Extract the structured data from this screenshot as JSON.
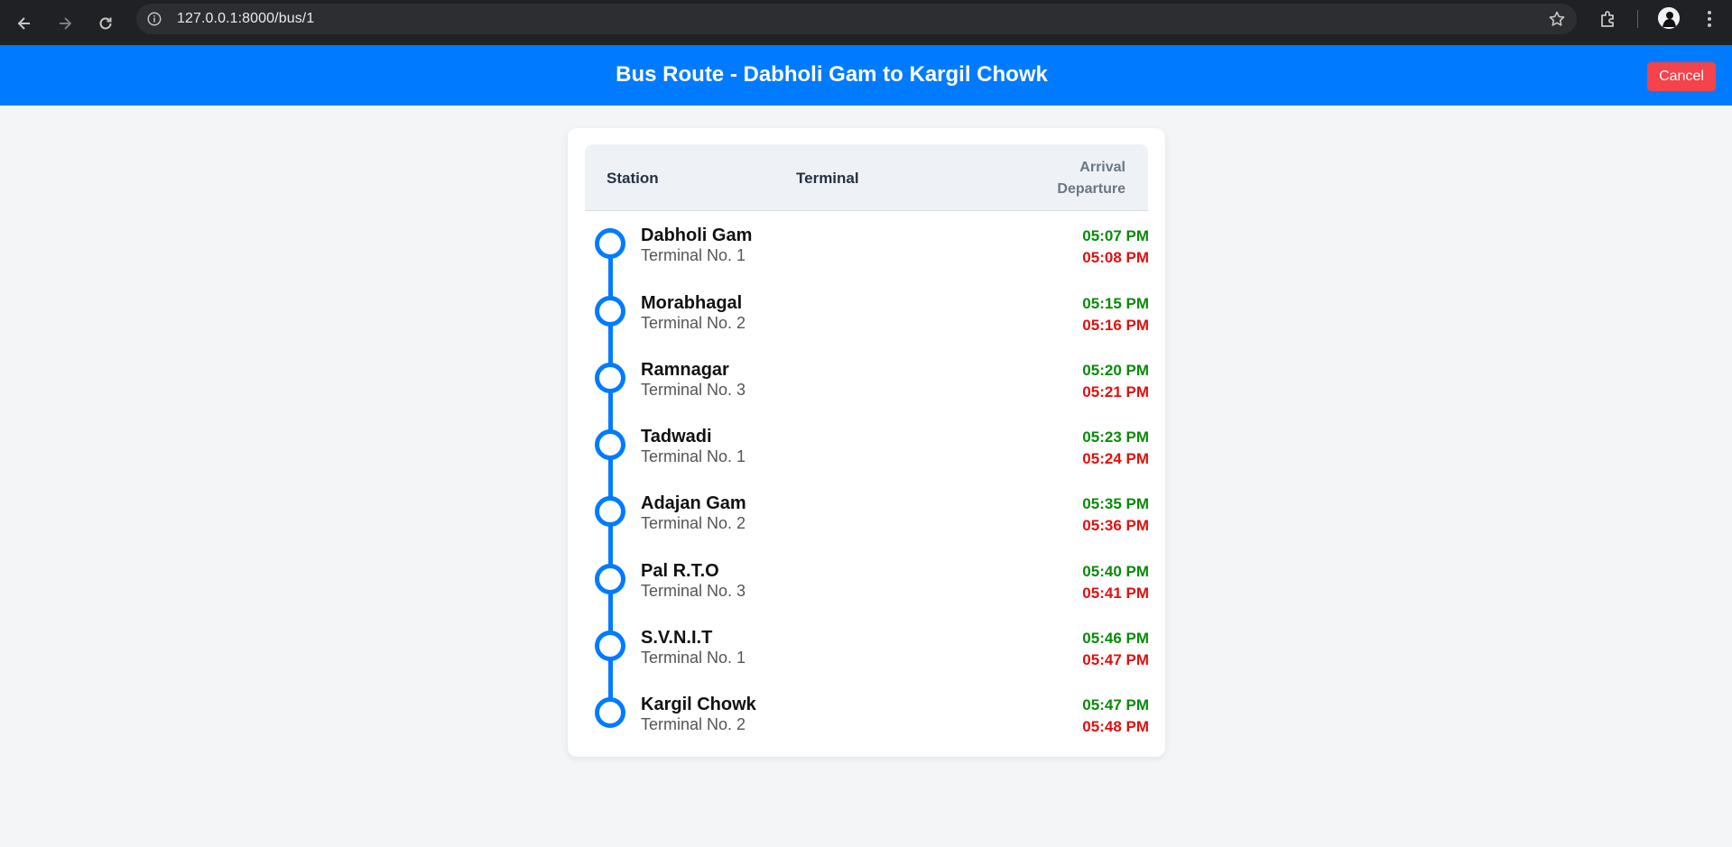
{
  "browser": {
    "url": "127.0.0.1:8000/bus/1"
  },
  "header": {
    "title": "Bus Route - Dabholi Gam to Kargil Chowk",
    "cancel_label": "Cancel"
  },
  "table": {
    "col_station": "Station",
    "col_terminal": "Terminal",
    "col_arrival": "Arrival",
    "col_departure": "Departure"
  },
  "stops": [
    {
      "name": "Dabholi Gam",
      "terminal": "Terminal No. 1",
      "arrival": "05:07 PM",
      "departure": "05:08 PM"
    },
    {
      "name": "Morabhagal",
      "terminal": "Terminal No. 2",
      "arrival": "05:15 PM",
      "departure": "05:16 PM"
    },
    {
      "name": "Ramnagar",
      "terminal": "Terminal No. 3",
      "arrival": "05:20 PM",
      "departure": "05:21 PM"
    },
    {
      "name": "Tadwadi",
      "terminal": "Terminal No. 1",
      "arrival": "05:23 PM",
      "departure": "05:24 PM"
    },
    {
      "name": "Adajan Gam",
      "terminal": "Terminal No. 2",
      "arrival": "05:35 PM",
      "departure": "05:36 PM"
    },
    {
      "name": "Pal R.T.O",
      "terminal": "Terminal No. 3",
      "arrival": "05:40 PM",
      "departure": "05:41 PM"
    },
    {
      "name": "S.V.N.I.T",
      "terminal": "Terminal No. 1",
      "arrival": "05:46 PM",
      "departure": "05:47 PM"
    },
    {
      "name": "Kargil Chowk",
      "terminal": "Terminal No. 2",
      "arrival": "05:47 PM",
      "departure": "05:48 PM"
    }
  ],
  "colors": {
    "header_bg": "#007bff",
    "route_accent": "#007bff",
    "arrival": "#0a8a0a",
    "departure": "#e01010",
    "cancel_bg": "#f4434a"
  },
  "icons": [
    "back-arrow-icon",
    "forward-arrow-icon",
    "reload-icon",
    "site-info-icon",
    "bookmark-star-icon",
    "extensions-icon",
    "profile-avatar-icon",
    "kebab-menu-icon"
  ]
}
